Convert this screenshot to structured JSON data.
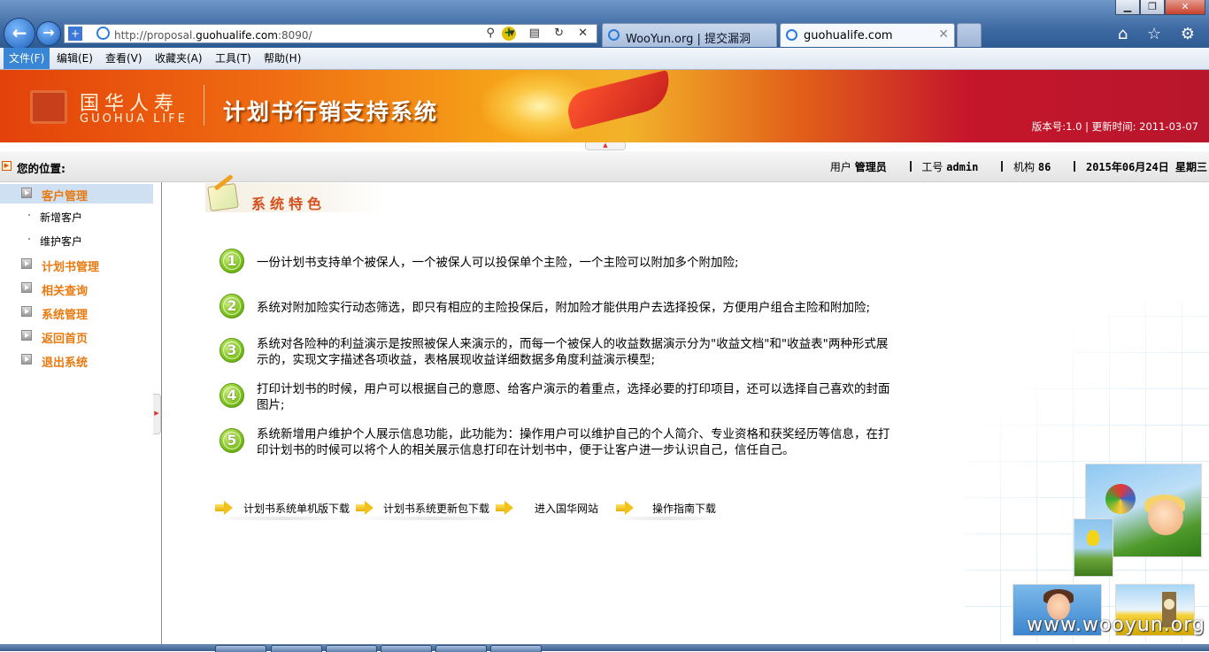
{
  "browser": {
    "window_buttons": [
      "▁",
      "❐",
      "✕"
    ],
    "back_glyph": "←",
    "forward_glyph": "→",
    "address_prefix": "http://proposal.",
    "address_host": "guohualife.com",
    "address_suffix": ":8090/",
    "address_tools": "⚲ ▾ ▤ ↻ ✕",
    "tabs": [
      {
        "label": "WooYun.org | 提交漏洞"
      },
      {
        "label": "guohualife.com"
      }
    ],
    "right_tools": "⌂ ☆ ⚙",
    "menu": [
      "文件(F)",
      "编辑(E)",
      "查看(V)",
      "收藏夹(A)",
      "工具(T)",
      "帮助(H)"
    ],
    "accent_color": "#3a86d6"
  },
  "banner": {
    "logo_cn": "国华人寿",
    "logo_en": "GUOHUA LIFE",
    "system_title": "计划书行销支持系统",
    "version_text": "版本号:1.0 | 更新时间: 2011-03-07"
  },
  "location": {
    "label": "您的位置:",
    "user_label": "用户",
    "user_value": "管理员",
    "empno_label": "工号",
    "empno_value": "admin",
    "org_label": "机构",
    "org_value": "86",
    "date": "2015年06月24日 星期三"
  },
  "sidebar": {
    "sections": [
      {
        "label": "客户管理",
        "selected": true,
        "children": [
          "新增客户",
          "维护客户"
        ]
      },
      {
        "label": "计划书管理"
      },
      {
        "label": "相关查询"
      },
      {
        "label": "系统管理"
      },
      {
        "label": "返回首页"
      },
      {
        "label": "退出系统"
      }
    ],
    "label_color": "#e87a10"
  },
  "main": {
    "feature_title": "系统特色",
    "features": [
      {
        "num": "1",
        "lines": [
          "一份计划书支持单个被保人，一个被保人可以投保单个主险，一个主险可以附加多个附加险;"
        ]
      },
      {
        "num": "2",
        "lines": [
          "系统对附加险实行动态筛选，即只有相应的主险投保后，附加险才能供用户去选择投保，方便用户组合主险和附加险;"
        ]
      },
      {
        "num": "3",
        "lines": [
          "系统对各险种的利益演示是按照被保人来演示的，而每一个被保人的收益数据演示分为\"收益文档\"和\"收益表\"两种形式展",
          "示的，实现文字描述各项收益，表格展现收益详细数据多角度利益演示模型;"
        ]
      },
      {
        "num": "4",
        "lines": [
          "打印计划书的时候，用户可以根据自己的意愿、给客户演示的着重点，选择必要的打印项目，还可以选择自己喜欢的封面",
          "图片;"
        ]
      },
      {
        "num": "5",
        "lines": [
          "系统新增用户维护个人展示信息功能，此功能为：操作用户可以维护自己的个人简介、专业资格和获奖经历等信息，在打",
          "印计划书的时候可以将个人的相关展示信息打印在计划书中，便于让客户进一步认识自己，信任自己。"
        ]
      }
    ],
    "links": [
      "计划书系统单机版下载",
      "计划书系统更新包下载",
      "进入国华网站",
      "操作指南下载"
    ]
  },
  "watermark": "www.wooyun.org"
}
